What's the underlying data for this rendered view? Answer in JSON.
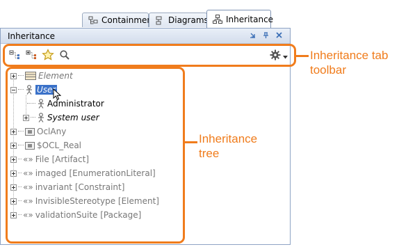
{
  "tabs": [
    {
      "label": "Containment",
      "icon": "containment-icon"
    },
    {
      "label": "Diagrams",
      "icon": "diagrams-icon"
    },
    {
      "label": "Inheritance",
      "icon": "inheritance-icon"
    }
  ],
  "panel": {
    "title": "Inheritance",
    "title_icons": [
      "minimize-icon",
      "pin-icon",
      "close-icon"
    ]
  },
  "toolbar": {
    "buttons": [
      "collapse-all-icon",
      "expand-all-icon",
      "favorite-star-icon",
      "search-icon"
    ],
    "options_button": "gear-icon"
  },
  "tree": {
    "items": [
      {
        "label": "Element",
        "icon": "class-icon"
      },
      {
        "label": "User",
        "icon": "actor-icon"
      },
      {
        "label": "Administrator",
        "icon": "actor-icon"
      },
      {
        "label": "System user",
        "icon": "actor-icon"
      },
      {
        "label": "OclAny",
        "icon": "datatype-icon"
      },
      {
        "label": "$OCL_Real",
        "icon": "datatype-icon"
      },
      {
        "label": "File [Artifact]",
        "icon": "stereotype-icon",
        "prefix": "«»"
      },
      {
        "label": "imaged [EnumerationLiteral]",
        "icon": "stereotype-icon",
        "prefix": "«»"
      },
      {
        "label": "invariant [Constraint]",
        "icon": "stereotype-icon",
        "prefix": "«»"
      },
      {
        "label": "InvisibleStereotype [Element]",
        "icon": "stereotype-icon",
        "prefix": "«»"
      },
      {
        "label": "validationSuite [Package]",
        "icon": "stereotype-icon",
        "prefix": "«»"
      }
    ]
  },
  "annotations": {
    "toolbar_line1": "Inheritance tab",
    "toolbar_line2": "toolbar",
    "tree_line1": "Inheritance",
    "tree_line2": "tree"
  },
  "colors": {
    "accent": "#f07c1c",
    "selection": "#3b72c9",
    "panel_border": "#8ea3c4"
  }
}
